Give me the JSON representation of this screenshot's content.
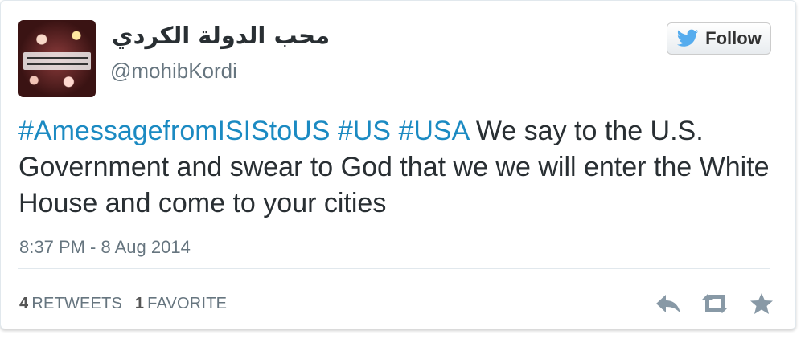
{
  "author": {
    "display_name": "محب الدولة الكردي",
    "handle": "@mohibKordi",
    "avatar_icon": "avatar-image"
  },
  "follow_button": {
    "label": "Follow",
    "icon": "twitter-bird-icon"
  },
  "tweet": {
    "hashtags": [
      "#AmessagefromISIStoUS",
      "#US",
      "#USA"
    ],
    "text": "We say to the U.S. Government and swear to God that we we will enter the White House and come to your cities",
    "timestamp": "8:37 PM - 8 Aug 2014"
  },
  "stats": {
    "retweets_count": "4",
    "retweets_label": "RETWEETS",
    "favorites_count": "1",
    "favorites_label": "FAVORITE"
  },
  "actions": [
    {
      "name": "reply",
      "icon": "reply-icon"
    },
    {
      "name": "retweet",
      "icon": "retweet-icon"
    },
    {
      "name": "favorite",
      "icon": "star-icon"
    }
  ],
  "colors": {
    "link": "#1b8ac2",
    "text": "#292f33",
    "muted": "#66757f",
    "bird": "#55acee"
  }
}
